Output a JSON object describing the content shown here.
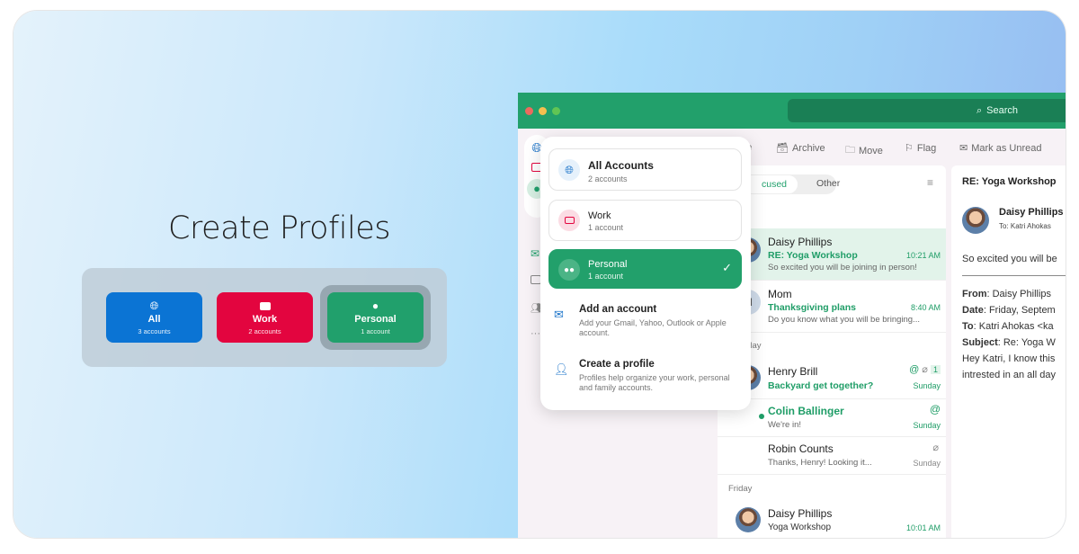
{
  "headline": "Create Profiles",
  "profile_picker": [
    {
      "label": "All",
      "sub": "3 accounts",
      "icon": "globe-icon",
      "color": "#0b74d4"
    },
    {
      "label": "Work",
      "sub": "2 accounts",
      "icon": "briefcase-icon",
      "color": "#e3053f"
    },
    {
      "label": "Personal",
      "sub": "1 account",
      "icon": "person-icon",
      "color": "#21a06c",
      "selected": true
    }
  ],
  "window": {
    "search_placeholder": "Search",
    "toolbar": [
      "ete",
      "Archive",
      "Move",
      "Flag",
      "Mark as Unread"
    ],
    "tabs": {
      "focused": "cused",
      "other": "Other"
    },
    "messages": [
      {
        "name": "Daisy Phillips",
        "subject": "RE: Yoga Workshop",
        "preview": "So excited you will be joining in person!",
        "time": "10:21 AM"
      },
      {
        "name": "Mom",
        "subject": "Thanksgiving plans",
        "preview": "Do you know what you will be bringing...",
        "time": "8:40 AM",
        "initial": "M"
      },
      {
        "name": "Henry Brill",
        "subject": "Backyard get together?",
        "time": "Sunday",
        "count": "1"
      },
      {
        "name": "Colin Ballinger",
        "preview": "We're in!",
        "time": "Sunday"
      },
      {
        "name": "Robin Counts",
        "preview": "Thanks, Henry! Looking it...",
        "time": "Sunday"
      },
      {
        "name": "Daisy Phillips",
        "subject": "Yoga Workshop",
        "time": "10:01 AM"
      }
    ],
    "sections": {
      "yesterday_partial": "y",
      "saturday_partial": "rday",
      "friday": "Friday"
    },
    "reading": {
      "title": "RE: Yoga Workshop",
      "sender": "Daisy Phillips",
      "to_label": "To:",
      "to": "Katri Ahokas",
      "body": "So excited you will be",
      "from_label": "From",
      "from": ": Daisy Phillips",
      "date_label": "Date",
      "date": ": Friday, Septem",
      "to2_label": "To",
      "to2": ": Katri Ahokas <ka",
      "subject_label": "Subject",
      "subject": ": Re: Yoga W",
      "line1": "Hey Katri, I know this",
      "line2": "intrested in an all day"
    }
  },
  "dropdown": {
    "accounts": [
      {
        "title": "All Accounts",
        "sub": "2 accounts"
      },
      {
        "title": "Work",
        "sub": "1 account"
      },
      {
        "title": "Personal",
        "sub": "1 account",
        "selected": true
      }
    ],
    "add_account": {
      "title": "Add an account",
      "desc": "Add your Gmail, Yahoo, Outlook or Apple account."
    },
    "create_profile": {
      "title": "Create a profile",
      "desc": "Profiles help organize your work, personal and family accounts."
    }
  }
}
